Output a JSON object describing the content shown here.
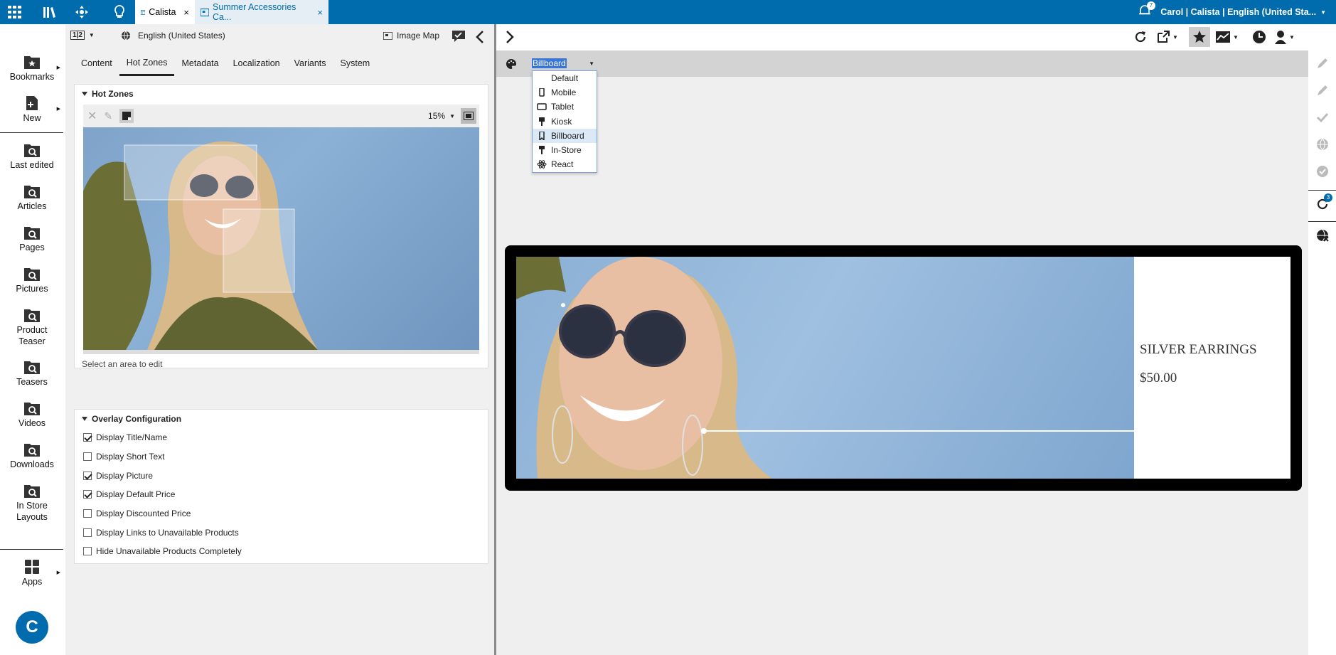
{
  "topbar": {
    "tabs": [
      {
        "label": "Calista",
        "close": "×"
      },
      {
        "label": "Summer Accessories Ca...",
        "close": "×"
      }
    ],
    "notifications": "7",
    "user": "Carol | Calista | English (United Sta..."
  },
  "left_nav": {
    "items": [
      {
        "label": "Bookmarks"
      },
      {
        "label": "New"
      },
      {
        "label": "Last edited"
      },
      {
        "label": "Articles"
      },
      {
        "label": "Pages"
      },
      {
        "label": "Pictures"
      },
      {
        "label_line1": "Product",
        "label_line2": "Teaser"
      },
      {
        "label": "Teasers"
      },
      {
        "label": "Videos"
      },
      {
        "label": "Downloads"
      },
      {
        "label_line1": "In Store",
        "label_line2": "Layouts"
      },
      {
        "label": "Apps"
      }
    ]
  },
  "left_panel": {
    "view_toggle": "1|2",
    "locale": "English (United States)",
    "image_map_label": "Image Map",
    "tabs": [
      "Content",
      "Hot Zones",
      "Metadata",
      "Localization",
      "Variants",
      "System"
    ],
    "active_tab": "Hot Zones",
    "hot_zones": {
      "title": "Hot Zones",
      "zoom": "15%",
      "status": "Select an area to edit"
    },
    "overlay": {
      "title": "Overlay Configuration",
      "options": [
        {
          "label": "Display Title/Name",
          "checked": true
        },
        {
          "label": "Display Short Text",
          "checked": false
        },
        {
          "label": "Display Picture",
          "checked": true
        },
        {
          "label": "Display Default Price",
          "checked": true
        },
        {
          "label": "Display Discounted Price",
          "checked": false
        },
        {
          "label": "Display Links to Unavailable Products",
          "checked": false
        },
        {
          "label": "Hide Unavailable Products Completely",
          "checked": false
        }
      ]
    }
  },
  "preview": {
    "device_selected": "Billboard",
    "devices": [
      {
        "label": "Default",
        "icon": "none"
      },
      {
        "label": "Mobile",
        "icon": "mobile-icon"
      },
      {
        "label": "Tablet",
        "icon": "tablet-icon"
      },
      {
        "label": "Kiosk",
        "icon": "kiosk-icon"
      },
      {
        "label": "Billboard",
        "icon": "billboard-icon"
      },
      {
        "label": "In-Store",
        "icon": "in-store-icon"
      },
      {
        "label": "React",
        "icon": "react-icon"
      }
    ],
    "product_title": "SILVER EARRINGS",
    "product_price": "$50.00",
    "side_badge": "3"
  }
}
